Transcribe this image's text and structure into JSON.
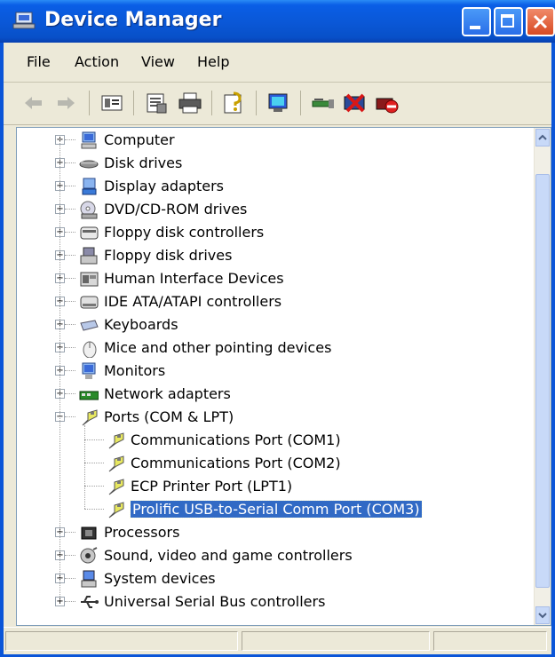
{
  "window": {
    "title": "Device Manager",
    "accent": "#0a58d8",
    "selection_color": "#316ac5"
  },
  "menu": [
    "File",
    "Action",
    "View",
    "Help"
  ],
  "toolbar": {
    "icons": [
      "back-arrow-icon",
      "forward-arrow-icon",
      "console-tree-icon",
      "properties-icon",
      "print-icon",
      "help-icon",
      "scan-hardware-icon",
      "update-driver-icon",
      "uninstall-icon",
      "disable-icon"
    ]
  },
  "tree": {
    "items": [
      {
        "label": "Computer",
        "icon": "computer-icon",
        "expander": "+"
      },
      {
        "label": "Disk drives",
        "icon": "disk-drive-icon",
        "expander": "+"
      },
      {
        "label": "Display adapters",
        "icon": "display-adapter-icon",
        "expander": "+"
      },
      {
        "label": "DVD/CD-ROM drives",
        "icon": "cdrom-icon",
        "expander": "+"
      },
      {
        "label": "Floppy disk controllers",
        "icon": "floppy-controller-icon",
        "expander": "+"
      },
      {
        "label": "Floppy disk drives",
        "icon": "floppy-drive-icon",
        "expander": "+"
      },
      {
        "label": "Human Interface Devices",
        "icon": "hid-icon",
        "expander": "+"
      },
      {
        "label": "IDE ATA/ATAPI controllers",
        "icon": "ide-controller-icon",
        "expander": "+"
      },
      {
        "label": "Keyboards",
        "icon": "keyboard-icon",
        "expander": "+"
      },
      {
        "label": "Mice and other pointing devices",
        "icon": "mouse-icon",
        "expander": "+"
      },
      {
        "label": "Monitors",
        "icon": "monitor-icon",
        "expander": "+"
      },
      {
        "label": "Network adapters",
        "icon": "network-adapter-icon",
        "expander": "+"
      },
      {
        "label": "Ports (COM & LPT)",
        "icon": "port-icon",
        "expander": "−"
      }
    ],
    "ports_children": [
      "Communications Port (COM1)",
      "Communications Port (COM2)",
      "ECP Printer Port (LPT1)",
      "Prolific USB-to-Serial Comm Port (COM3)"
    ],
    "selected_child": "Prolific USB-to-Serial Comm Port (COM3)",
    "items_after": [
      {
        "label": "Processors",
        "icon": "processor-icon",
        "expander": "+"
      },
      {
        "label": "Sound, video and game controllers",
        "icon": "sound-icon",
        "expander": "+"
      },
      {
        "label": "System devices",
        "icon": "system-device-icon",
        "expander": "+"
      },
      {
        "label": "Universal Serial Bus controllers",
        "icon": "usb-icon",
        "expander": "+"
      }
    ]
  }
}
